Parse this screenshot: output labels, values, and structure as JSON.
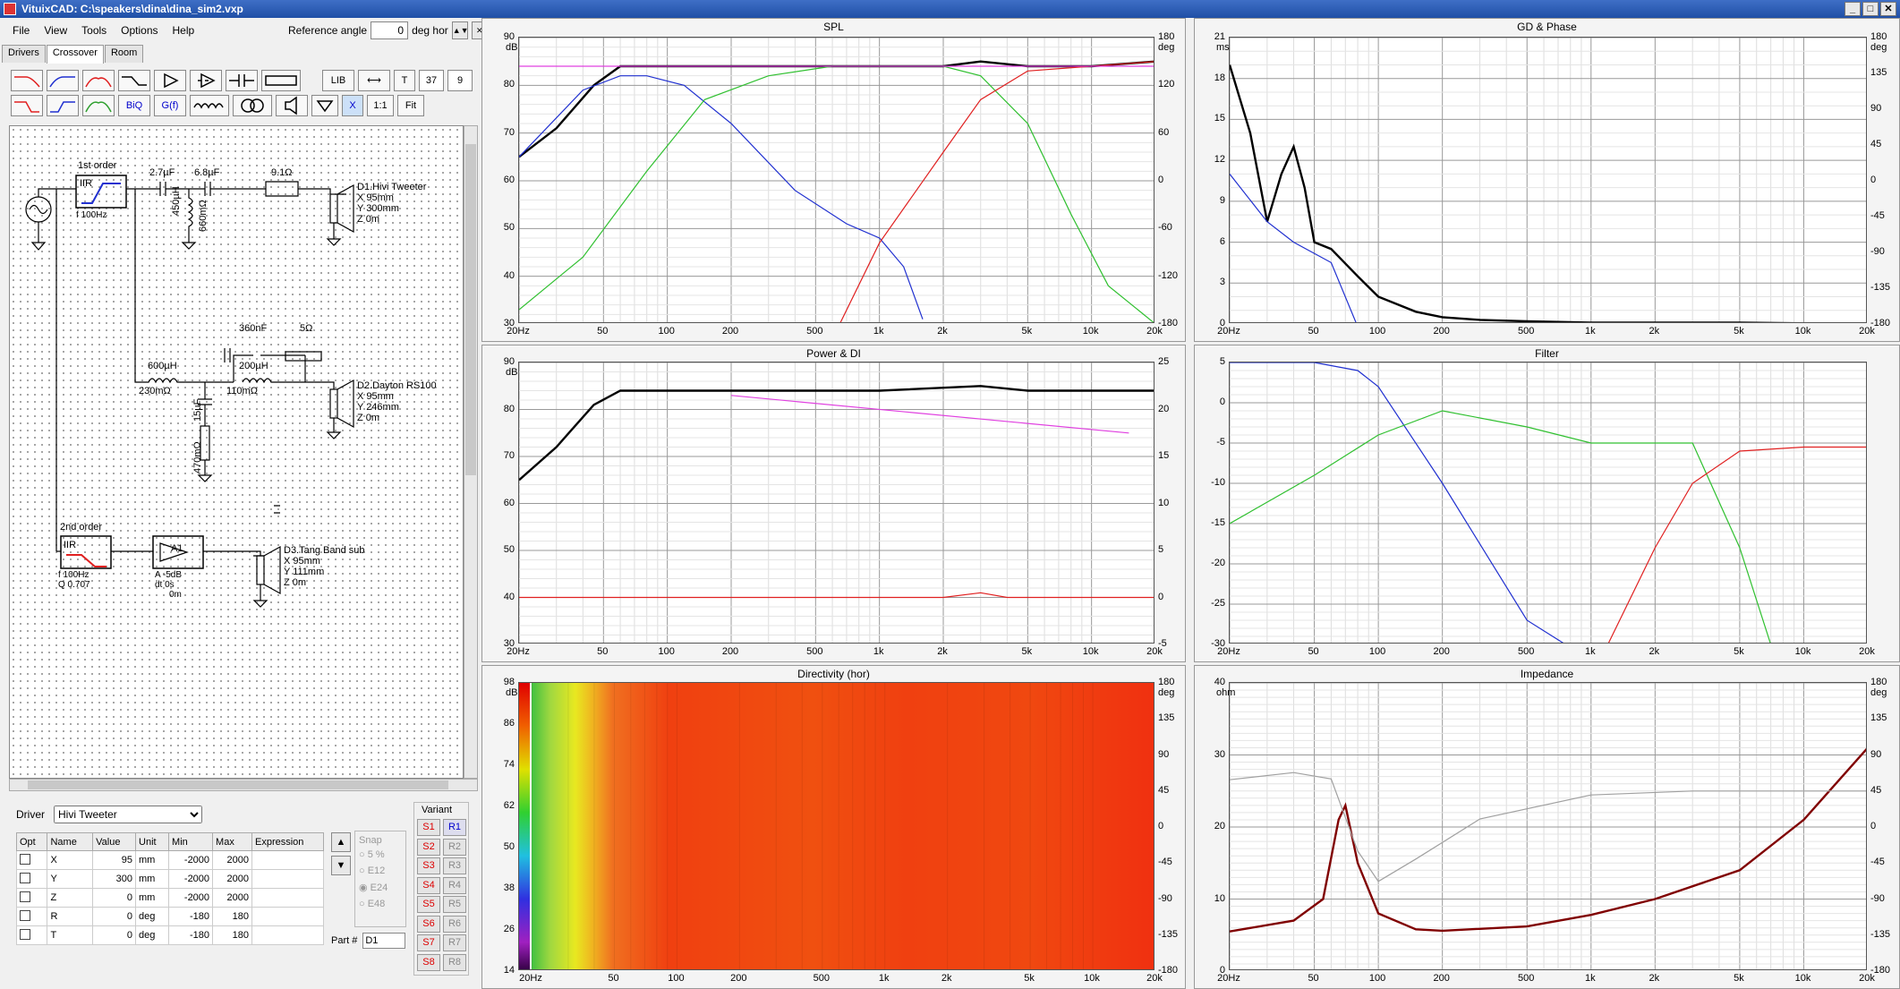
{
  "window": {
    "title": "VituixCAD: C:\\speakers\\dina\\dina_sim2.vxp",
    "min": "_",
    "max": "□",
    "close": "✕"
  },
  "menu": [
    "File",
    "View",
    "Tools",
    "Options",
    "Help"
  ],
  "reference_angle": {
    "label": "Reference angle",
    "value": "0",
    "unit": "deg hor"
  },
  "tabs": [
    "Drivers",
    "Crossover",
    "Room"
  ],
  "toolbar": {
    "labels": [
      "LIB",
      "T",
      "37",
      "9",
      "BiQ",
      "G(f)",
      "X",
      "1:1",
      "Fit"
    ]
  },
  "schematic": {
    "filter1_title": "1st order",
    "filter1_type": "IIR",
    "filter1_params": "f 100Hz",
    "c1": "2.7µF",
    "c2": "6.8µF",
    "r1": "9.1Ω",
    "l1": "450µH",
    "l1r": "660mΩ",
    "d1_name": "D1.Hivi Tweeter",
    "d1_x": "X 95mm",
    "d1_y": "Y 300mm",
    "d1_z": "Z 0m",
    "c3": "360nF",
    "r2": "5Ω",
    "l2": "600µH",
    "l2r": "230mΩ",
    "l3": "200µH",
    "l3r": "110mΩ",
    "c4": "15µF",
    "r3": "470mΩ",
    "d2_name": "D2.Dayton RS100",
    "d2_x": "X 95mm",
    "d2_y": "Y 246mm",
    "d2_z": "Z 0m",
    "filter2_title": "2nd order",
    "filter2_type": "IIR",
    "filter2_f": "f 100Hz",
    "filter2_q": "Q 0.707",
    "amp_label": "A1",
    "amp_a": "A -5dB",
    "amp_dt": "dt 0s",
    "amp_m": "0m",
    "d3_name": "D3.Tang Band sub",
    "d3_x": "X 95mm",
    "d3_y": "Y 111mm",
    "d3_z": "Z 0m"
  },
  "driver": {
    "label": "Driver",
    "selected": "Hivi Tweeter"
  },
  "params": {
    "headers": [
      "Opt",
      "Name",
      "Value",
      "Unit",
      "Min",
      "Max",
      "Expression"
    ],
    "rows": [
      {
        "name": "X",
        "value": "95",
        "unit": "mm",
        "min": "-2000",
        "max": "2000"
      },
      {
        "name": "Y",
        "value": "300",
        "unit": "mm",
        "min": "-2000",
        "max": "2000"
      },
      {
        "name": "Z",
        "value": "0",
        "unit": "mm",
        "min": "-2000",
        "max": "2000"
      },
      {
        "name": "R",
        "value": "0",
        "unit": "deg",
        "min": "-180",
        "max": "180"
      },
      {
        "name": "T",
        "value": "0",
        "unit": "deg",
        "min": "-180",
        "max": "180"
      }
    ]
  },
  "snap": {
    "title": "Snap",
    "options": [
      "5 %",
      "E12",
      "E24",
      "E48"
    ],
    "selected": "E24"
  },
  "part": {
    "label": "Part #",
    "value": "D1"
  },
  "variant": {
    "title": "Variant",
    "s": [
      "S1",
      "S2",
      "S3",
      "S4",
      "S5",
      "S6",
      "S7",
      "S8"
    ],
    "r": [
      "R1",
      "R2",
      "R3",
      "R4",
      "R5",
      "R6",
      "R7",
      "R8"
    ]
  },
  "freq_ticks": [
    "20Hz",
    "50",
    "100",
    "200",
    "500",
    "1k",
    "2k",
    "5k",
    "10k",
    "20k"
  ],
  "charts": {
    "spl": {
      "title": "SPL",
      "yl_unit": "dB",
      "yr_unit": "deg",
      "yl": [
        "90",
        "80",
        "70",
        "60",
        "50",
        "40",
        "30"
      ],
      "yr": [
        "180",
        "120",
        "60",
        "0",
        "-60",
        "-120",
        "-180"
      ]
    },
    "gd": {
      "title": "GD & Phase",
      "yl_unit": "ms",
      "yr_unit": "deg",
      "yl": [
        "21",
        "18",
        "15",
        "12",
        "9",
        "6",
        "3",
        "0"
      ],
      "yr": [
        "180",
        "135",
        "90",
        "45",
        "0",
        "-45",
        "-90",
        "-135",
        "-180"
      ]
    },
    "power": {
      "title": "Power & DI",
      "yl_unit": "dB",
      "yl": [
        "90",
        "80",
        "70",
        "60",
        "50",
        "40",
        "30"
      ],
      "yr": [
        "25",
        "20",
        "15",
        "10",
        "5",
        "0",
        "-5"
      ]
    },
    "filter": {
      "title": "Filter",
      "yl": [
        "5",
        "0",
        "-5",
        "-10",
        "-15",
        "-20",
        "-25",
        "-30"
      ]
    },
    "directivity": {
      "title": "Directivity (hor)",
      "yl_unit": "dB",
      "yr_unit": "deg",
      "scale": [
        "98",
        "86",
        "74",
        "62",
        "50",
        "38",
        "26",
        "14"
      ],
      "yr": [
        "180",
        "135",
        "90",
        "45",
        "0",
        "-45",
        "-90",
        "-135",
        "-180"
      ]
    },
    "impedance": {
      "title": "Impedance",
      "yl_unit": "ohm",
      "yr_unit": "deg",
      "yl": [
        "40",
        "30",
        "20",
        "10",
        "0"
      ],
      "yr": [
        "180",
        "135",
        "90",
        "45",
        "0",
        "-45",
        "-90",
        "-135",
        "-180"
      ]
    }
  },
  "colors": {
    "tweeter": "#2030d0",
    "mid": "#30c030",
    "sub": "#e02020",
    "sum": "#000000",
    "reference": "#e040e0",
    "impedance": "#800000",
    "phase": "#a0a0a0"
  },
  "chart_data": [
    {
      "type": "line",
      "title": "SPL",
      "xscale": "log",
      "xlim": [
        20,
        20000
      ],
      "ylim": [
        30,
        90
      ],
      "y2lim": [
        -180,
        180
      ],
      "series": [
        {
          "color": "#000000",
          "x": [
            20,
            30,
            45,
            60,
            80,
            120,
            200,
            500,
            1000,
            2000,
            3000,
            5000,
            10000,
            20000
          ],
          "y": [
            65,
            71,
            80,
            84,
            84,
            84,
            84,
            84,
            84,
            84,
            85,
            84,
            84,
            85
          ]
        },
        {
          "color": "#2030d0",
          "x": [
            20,
            40,
            60,
            80,
            120,
            200,
            400,
            700,
            1000,
            1300,
            1600
          ],
          "y": [
            65,
            79,
            82,
            82,
            80,
            72,
            58,
            51,
            48,
            42,
            31
          ]
        },
        {
          "color": "#30c030",
          "x": [
            20,
            40,
            80,
            150,
            300,
            600,
            1000,
            2000,
            3000,
            5000,
            8000,
            12000,
            20000
          ],
          "y": [
            33,
            44,
            62,
            77,
            82,
            84,
            84,
            84,
            82,
            72,
            53,
            38,
            30
          ]
        },
        {
          "color": "#e02020",
          "x": [
            650,
            1000,
            2000,
            3000,
            5000,
            10000,
            20000
          ],
          "y": [
            30,
            47,
            66,
            77,
            83,
            84,
            85
          ]
        },
        {
          "color": "#e040e0",
          "x": [
            20,
            20000
          ],
          "y": [
            84,
            84
          ]
        }
      ]
    },
    {
      "type": "line",
      "title": "GD & Phase",
      "xscale": "log",
      "xlim": [
        20,
        20000
      ],
      "ylim": [
        0,
        21
      ],
      "y2lim": [
        -180,
        180
      ],
      "series": [
        {
          "color": "#000000",
          "x": [
            20,
            25,
            30,
            35,
            40,
            45,
            50,
            60,
            80,
            100,
            150,
            200,
            300,
            500,
            1000,
            5000,
            20000
          ],
          "y": [
            19,
            14,
            7.5,
            11,
            13,
            10,
            6,
            5.5,
            3.5,
            2,
            0.9,
            0.5,
            0.3,
            0.2,
            0.1,
            0.1,
            0
          ]
        },
        {
          "color": "#2030d0",
          "x": [
            20,
            30,
            40,
            60,
            79
          ],
          "y": [
            11,
            7.5,
            6,
            4.5,
            0
          ]
        }
      ]
    },
    {
      "type": "line",
      "title": "Power & DI",
      "xscale": "log",
      "xlim": [
        20,
        20000
      ],
      "ylim": [
        30,
        90
      ],
      "y2lim": [
        -5,
        25
      ],
      "series": [
        {
          "color": "#000000",
          "x": [
            20,
            30,
            45,
            60,
            100,
            500,
            1000,
            3000,
            5000,
            10000,
            20000
          ],
          "y": [
            65,
            72,
            81,
            84,
            84,
            84,
            84,
            85,
            84,
            84,
            84
          ]
        },
        {
          "color": "#e040e0",
          "x": [
            200,
            15000
          ],
          "y": [
            83,
            75
          ]
        },
        {
          "color": "#e02020",
          "x": [
            20,
            2000,
            3000,
            4000,
            20000
          ],
          "y": [
            40,
            40,
            41,
            40,
            40
          ]
        }
      ]
    },
    {
      "type": "line",
      "title": "Filter",
      "xscale": "log",
      "xlim": [
        20,
        20000
      ],
      "ylim": [
        -30,
        5
      ],
      "series": [
        {
          "color": "#2030d0",
          "x": [
            20,
            50,
            80,
            100,
            200,
            500,
            1000
          ],
          "y": [
            5,
            5,
            4,
            2,
            -10,
            -27,
            -32
          ]
        },
        {
          "color": "#30c030",
          "x": [
            20,
            50,
            100,
            200,
            500,
            1000,
            2000,
            3000,
            5000,
            7000
          ],
          "y": [
            -15,
            -9,
            -4,
            -1,
            -3,
            -5,
            -5,
            -5,
            -18,
            -30
          ]
        },
        {
          "color": "#e02020",
          "x": [
            1200,
            2000,
            3000,
            5000,
            10000,
            20000
          ],
          "y": [
            -30,
            -18,
            -10,
            -6,
            -5.5,
            -5.5
          ]
        }
      ]
    },
    {
      "type": "heatmap",
      "title": "Directivity (hor)",
      "xscale": "log",
      "xlim": [
        20,
        20000
      ],
      "ylim": [
        -180,
        180
      ],
      "zlim": [
        14,
        98
      ]
    },
    {
      "type": "line",
      "title": "Impedance",
      "xscale": "log",
      "xlim": [
        20,
        20000
      ],
      "ylim": [
        0,
        40
      ],
      "y2lim": [
        -180,
        180
      ],
      "series": [
        {
          "color": "#800000",
          "x": [
            20,
            40,
            55,
            65,
            70,
            80,
            100,
            150,
            200,
            500,
            1000,
            2000,
            5000,
            10000,
            20000
          ],
          "y": [
            5.5,
            7,
            10,
            21,
            23,
            15,
            8,
            5.8,
            5.6,
            6.2,
            7.8,
            10,
            14,
            21,
            31
          ]
        },
        {
          "color": "#a0a0a0",
          "x": [
            20,
            40,
            60,
            80,
            100,
            150,
            300,
            1000,
            3000,
            10000,
            20000
          ],
          "y": [
            59,
            68,
            60,
            -30,
            -68,
            -40,
            10,
            40,
            45,
            45,
            45
          ]
        }
      ]
    }
  ]
}
